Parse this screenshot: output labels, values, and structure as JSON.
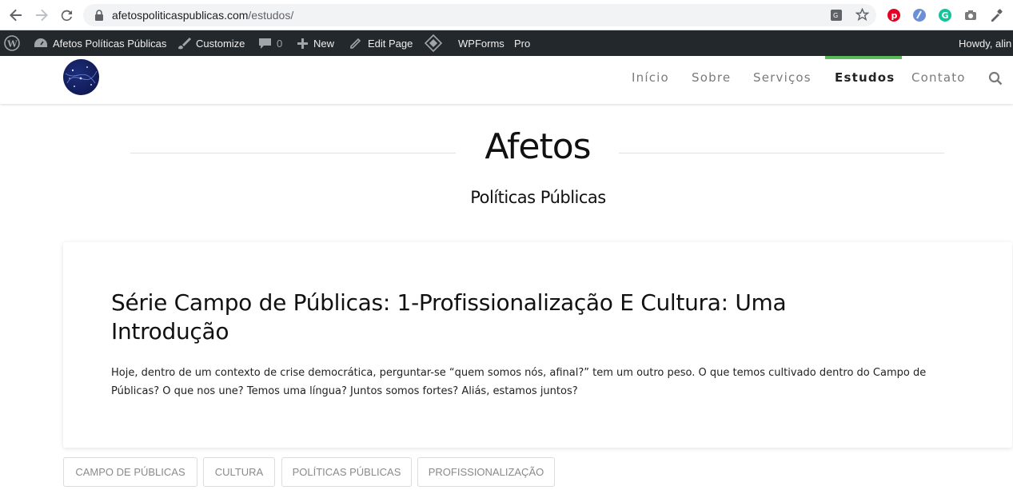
{
  "browser": {
    "url_domain": "afetospoliticaspublicas.com",
    "url_path": "/estudos/"
  },
  "adminbar": {
    "site_name": "Afetos Políticas Públicas",
    "customize": "Customize",
    "comments_count": "0",
    "new": "New",
    "edit_page": "Edit Page",
    "wpforms": "WPForms",
    "pro": "Pro",
    "howdy": "Howdy, alin"
  },
  "nav": {
    "items": [
      {
        "label": "Início"
      },
      {
        "label": "Sobre"
      },
      {
        "label": "Serviços"
      },
      {
        "label": "Estudos"
      },
      {
        "label": "Contato"
      }
    ],
    "active_color": "#5cb85c"
  },
  "site": {
    "title": "Afetos",
    "subtitle": "Políticas Públicas"
  },
  "post": {
    "title": "Série Campo de Públicas: 1-Profissionalização E Cultura: Uma Introdução",
    "excerpt": "Hoje, dentro de um contexto de crise democrática, perguntar-se “quem somos nós, afinal?” tem um outro peso. O que temos cultivado dentro do Campo de Públicas? O que nos une? Temos uma língua? Juntos somos fortes? Aliás, estamos juntos?"
  },
  "tags": [
    {
      "label": "CAMPO DE PÚBLICAS"
    },
    {
      "label": "CULTURA"
    },
    {
      "label": "POLÍTICAS PÚBLICAS"
    },
    {
      "label": "PROFISSIONALIZAÇÃO"
    }
  ]
}
